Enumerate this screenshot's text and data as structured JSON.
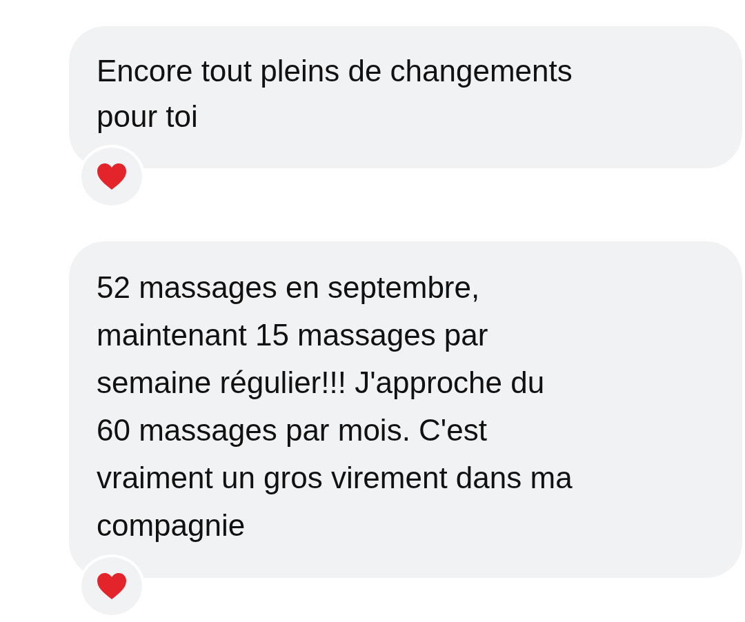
{
  "messages": [
    {
      "text": "Encore tout pleins de changements\npour toi",
      "reaction": true
    },
    {
      "text": "52 massages en septembre,\nmaintenant 15 massages par\nsemaine régulier!!! J'approche du\n60 massages par mois. C'est\nvraiment un gros virement dans ma\ncompagnie",
      "reaction": true
    }
  ]
}
